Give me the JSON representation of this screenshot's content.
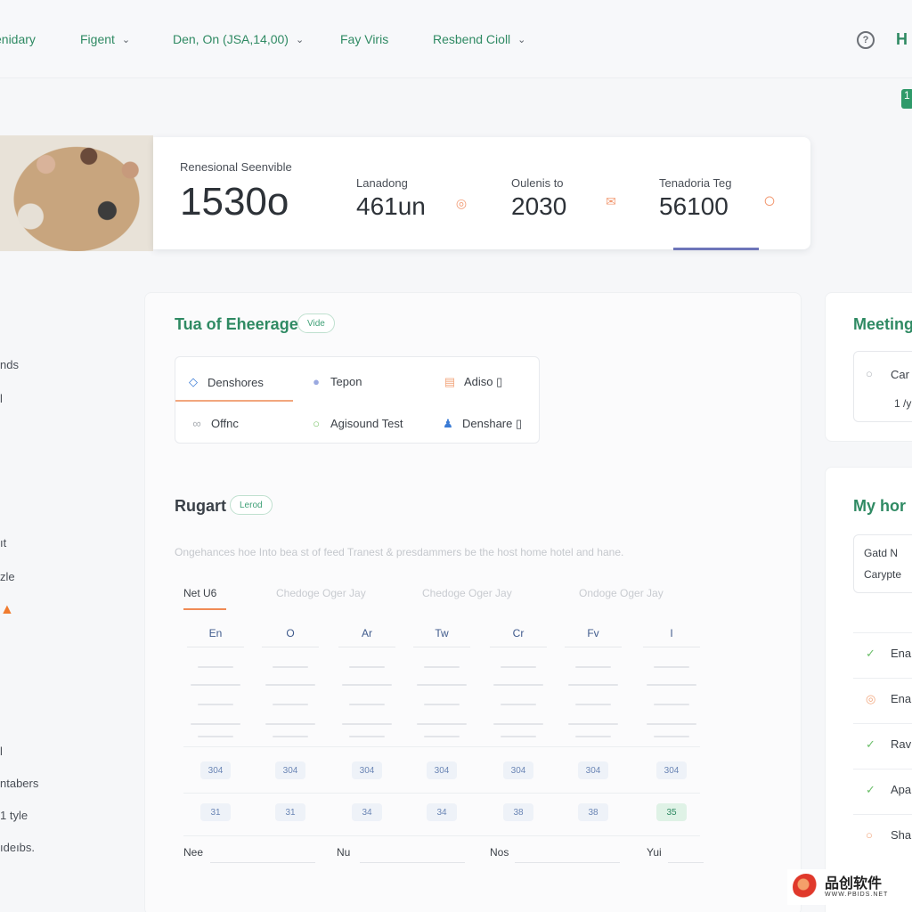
{
  "nav": {
    "items": [
      {
        "label": "enidary",
        "dropdown": false
      },
      {
        "label": "Figent",
        "dropdown": true
      },
      {
        "label": "Den, On (JSA,14,00)",
        "dropdown": true
      },
      {
        "label": "Fay Viris",
        "dropdown": false
      },
      {
        "label": "Resbend Cioll",
        "dropdown": true
      }
    ],
    "help_icon": "?",
    "user_initial": "H",
    "corner_badge": "1"
  },
  "stats": {
    "items": [
      {
        "label": "Renesional Seenvible",
        "value": "1530o"
      },
      {
        "label": "Lanadong",
        "value": "461un",
        "icon": "alert-icon",
        "icon_glyph": "◎"
      },
      {
        "label": "Oulenis to",
        "value": "2030",
        "icon": "mail-icon",
        "icon_glyph": "✉"
      },
      {
        "label": "Tenadoria Teg",
        "value": "56100",
        "icon": "circle-icon",
        "icon_glyph": "○"
      }
    ]
  },
  "sidebar_fragments": [
    "nds",
    "l",
    "ıt",
    "zle",
    "l",
    "ntabers",
    "1 tyle",
    "ıdeıbs."
  ],
  "tools": {
    "title": "Tua of Eheerages",
    "badge": "Vide",
    "items": [
      {
        "label": "Denshores",
        "icon": "compass-icon",
        "glyph": "◇",
        "color": "#3a7bd5"
      },
      {
        "label": "Tepon",
        "icon": "globe-icon",
        "glyph": "●",
        "color": "#9aa9e0"
      },
      {
        "label": "Adiso ▯",
        "icon": "box-icon",
        "glyph": "▤",
        "color": "#f2a77e"
      },
      {
        "label": "Offnc",
        "icon": "link-icon",
        "glyph": "∞",
        "color": "#a8acb2"
      },
      {
        "label": "Agisound Test",
        "icon": "ring-icon",
        "glyph": "○",
        "color": "#7cc46a"
      },
      {
        "label": "Denshare ▯",
        "icon": "people-icon",
        "glyph": "♟",
        "color": "#3a7bd5"
      }
    ]
  },
  "schedule": {
    "title": "Rugart",
    "badge": "Lerod",
    "description": "Ongehances hoe Into bea st of feed Tranest & presdammers be the host home hotel and hane.",
    "tabs": [
      "Net U6",
      "Chedoge Oger Jay",
      "Chedoge Oger Jay",
      "Ondoge Oger Jay"
    ],
    "day_headers": [
      "En",
      "O",
      "Ar",
      "Tw",
      "Cr",
      "Fv",
      "I"
    ],
    "chip_row1": [
      "304",
      "304",
      "304",
      "304",
      "304",
      "304",
      "304"
    ],
    "chip_row2": [
      "31",
      "31",
      "34",
      "34",
      "38",
      "38",
      "35"
    ],
    "active_chip_index": 6,
    "footer_labels": [
      "Nee",
      "Nu",
      "Nos",
      "Yui"
    ]
  },
  "right": {
    "meetings_title": "Meeting",
    "meeting_item": "Car",
    "meeting_sub": "1 /y",
    "my_title": "My hor",
    "card_line1": "Gatd N",
    "card_line2": "Carypte",
    "list": [
      {
        "label": "Ena",
        "icon": "check-icon",
        "glyph": "✓",
        "color": "#6cbf6a"
      },
      {
        "label": "Ena",
        "icon": "clock-icon",
        "glyph": "◎",
        "color": "#f2a77e"
      },
      {
        "label": "Rav",
        "icon": "check-icon",
        "glyph": "✓",
        "color": "#6cbf6a"
      },
      {
        "label": "Apa",
        "icon": "check-icon",
        "glyph": "✓",
        "color": "#6cbf6a"
      },
      {
        "label": "Sha",
        "icon": "clock-icon",
        "glyph": "○",
        "color": "#f2a77e"
      }
    ]
  },
  "watermark": {
    "main": "品创软件",
    "sub": "WWW.PBIDS.NET"
  },
  "colors": {
    "accent_green": "#2f8a63",
    "accent_orange": "#f08a55",
    "accent_indigo": "#6d75b9"
  }
}
